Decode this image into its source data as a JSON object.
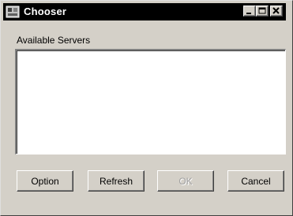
{
  "window": {
    "title": "Chooser",
    "controls": {
      "minimize_icon": "minimize-icon",
      "maximize_icon": "maximize-icon",
      "close_icon": "close-icon"
    },
    "app_icon": "chooser-app-icon"
  },
  "servers": {
    "label": "Available Servers",
    "items": []
  },
  "buttons": {
    "option": "Option",
    "refresh": "Refresh",
    "ok": "OK",
    "cancel": "Cancel"
  },
  "colors": {
    "title_bar": "#000000",
    "face": "#d4d0c8",
    "list_background": "#ffffff",
    "disabled_text": "#a0a0a0"
  }
}
